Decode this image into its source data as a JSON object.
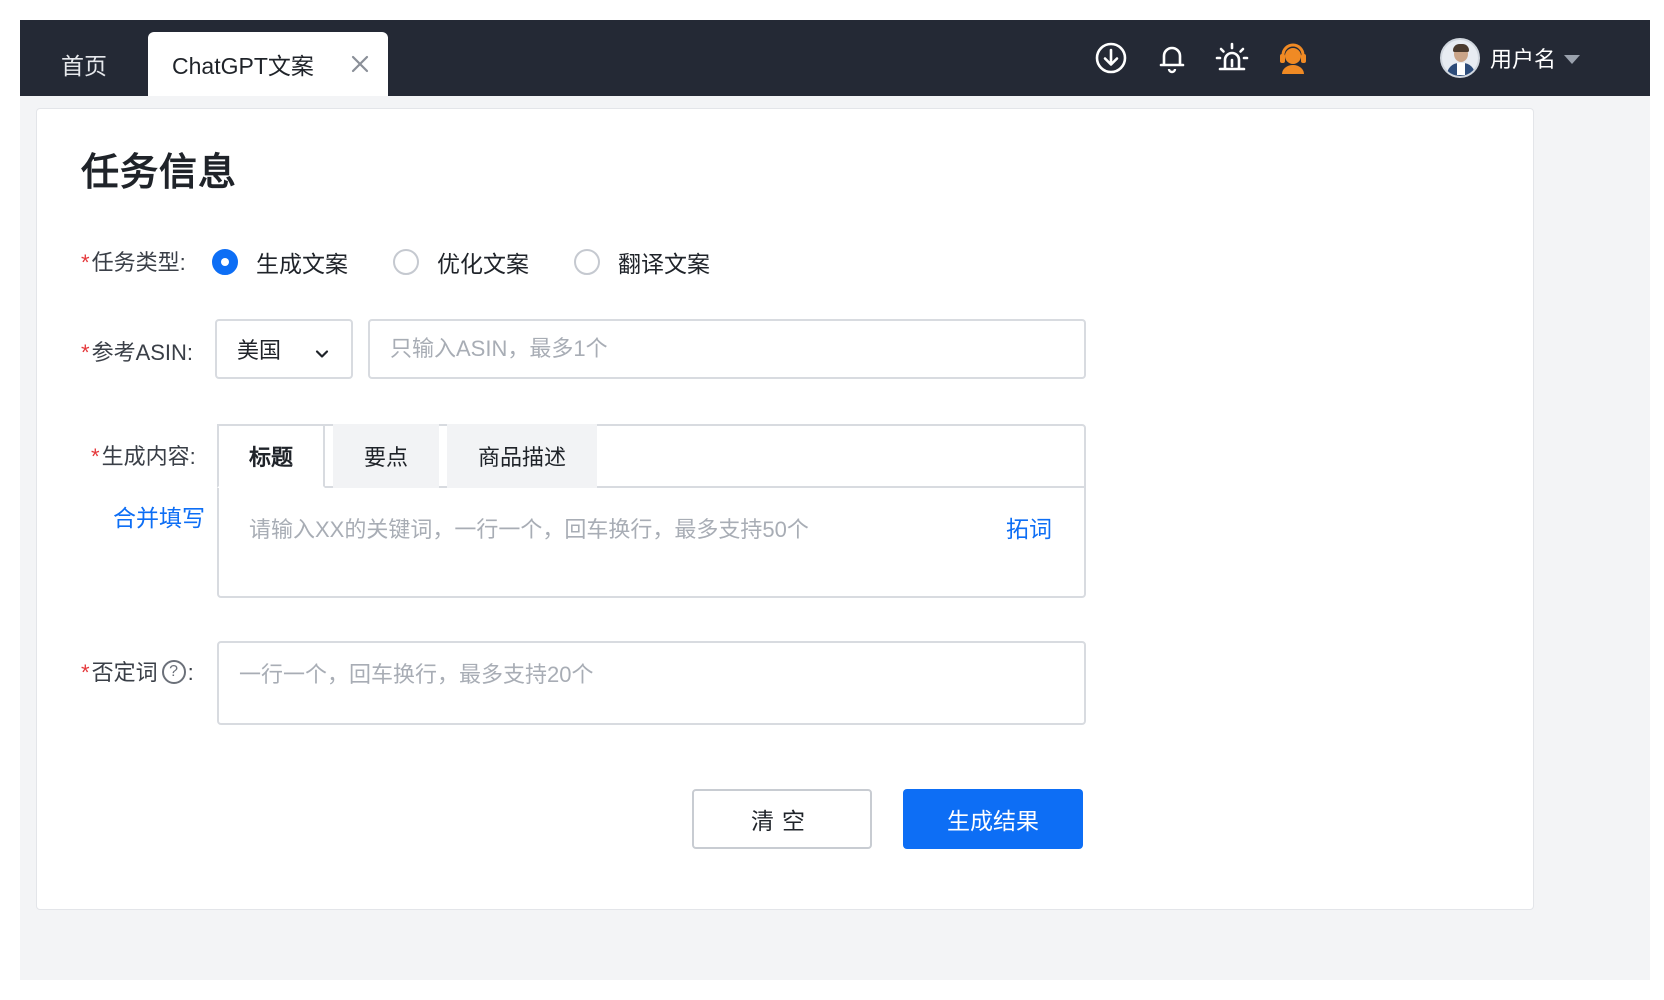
{
  "topbar": {
    "tabs": [
      {
        "label": "首页"
      },
      {
        "label": "ChatGPT文案",
        "active": true
      }
    ],
    "icons": [
      "download-icon",
      "bell-icon",
      "alarm-icon",
      "customer-service-icon"
    ],
    "user": {
      "name": "用户名"
    }
  },
  "form": {
    "title": "任务信息",
    "required_mark": "*",
    "task_type": {
      "label": "任务类型:",
      "options": [
        "生成文案",
        "优化文案",
        "翻译文案"
      ],
      "selected": "生成文案"
    },
    "asin": {
      "label": "参考ASIN:",
      "market": "美国",
      "placeholder": "只输入ASIN，最多1个",
      "value": ""
    },
    "content": {
      "label": "生成内容:",
      "merge_link": "合并填写",
      "tabs": [
        "标题",
        "要点",
        "商品描述"
      ],
      "active_tab": "标题",
      "placeholder": "请输入XX的关键词，一行一个，回车换行，最多支持50个",
      "expand_link": "拓词"
    },
    "negative": {
      "label_prefix": "否定词",
      "help": "?",
      "label_suffix": ":",
      "placeholder": "一行一个，回车换行，最多支持20个"
    },
    "buttons": {
      "clear": "清空",
      "generate": "生成结果"
    }
  },
  "colors": {
    "topbar": "#242935",
    "primary": "#0d6ef5",
    "required": "#e5383b"
  }
}
